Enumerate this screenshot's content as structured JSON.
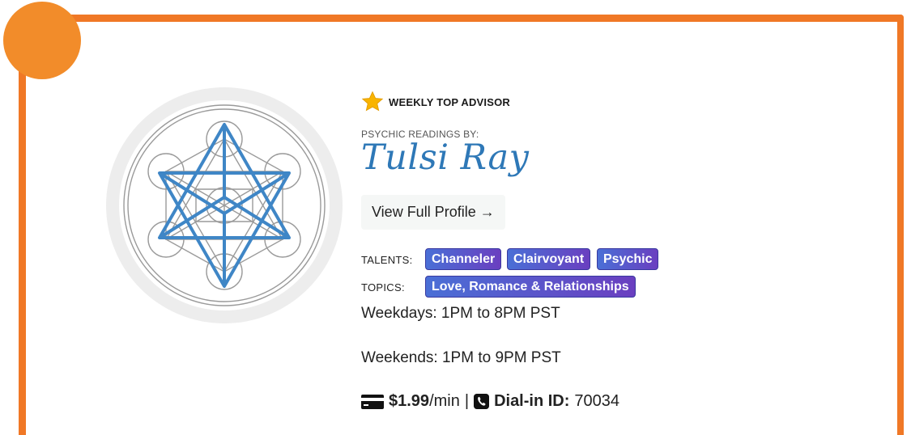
{
  "badge": {
    "label": "WEEKLY TOP ADVISOR",
    "icon": "star-icon"
  },
  "advisor": {
    "pre_title": "PSYCHIC READINGS BY:",
    "name": "Tulsi Ray",
    "profile_button": "View Full Profile →"
  },
  "talents": {
    "label": "TALENTS:",
    "items": [
      "Channeler",
      "Clairvoyant",
      "Psychic"
    ]
  },
  "topics": {
    "label": "TOPICS:",
    "items": [
      "Love, Romance & Relationships"
    ]
  },
  "hours": {
    "weekdays": "Weekdays: 1PM to 8PM PST",
    "weekends": "Weekends: 1PM to 9PM PST"
  },
  "pricing": {
    "price": "$1.99",
    "unit": "/min",
    "separator": "|",
    "dial_label": "Dial-in ID:",
    "dial_id": "70034"
  },
  "colors": {
    "accent": "#f07826",
    "name": "#2e78b7",
    "tag_start": "#4a6fd6",
    "tag_end": "#6a3fc0"
  }
}
